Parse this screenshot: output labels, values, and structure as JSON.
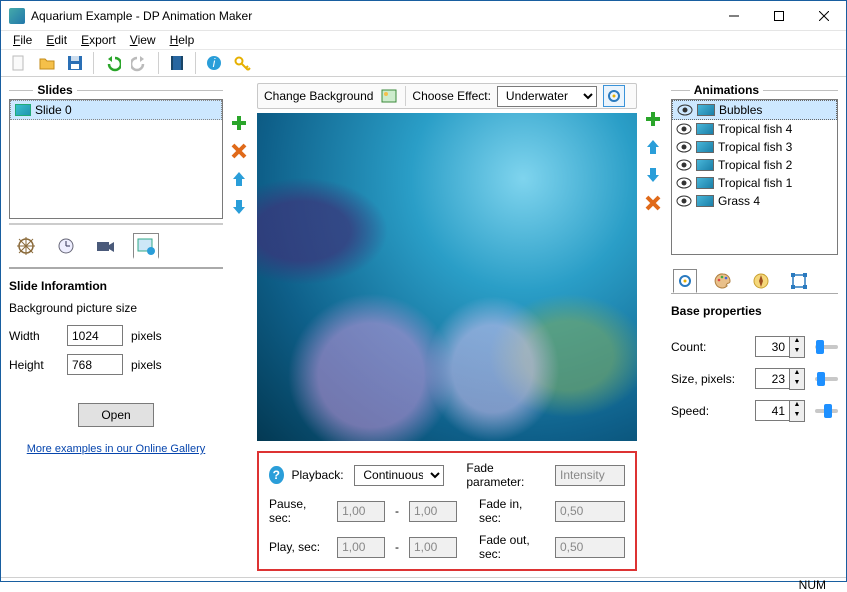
{
  "title": "Aquarium Example - DP Animation Maker",
  "menu": {
    "file": "File",
    "edit": "Edit",
    "export": "Export",
    "view": "View",
    "help": "Help"
  },
  "left": {
    "slides_title": "Slides",
    "slide0": "Slide 0",
    "info_title": "Slide Inforamtion",
    "bgsize_label": "Background picture size",
    "width_label": "Width",
    "width_value": "1024",
    "height_label": "Height",
    "height_value": "768",
    "pixels": "pixels",
    "open": "Open",
    "gallery_link": "More examples in our Online Gallery"
  },
  "center": {
    "change_bg": "Change Background",
    "choose_effect": "Choose Effect:",
    "effect_value": "Underwater",
    "playback_label": "Playback:",
    "playback_value": "Continuous",
    "fade_param_label": "Fade parameter:",
    "fade_param_value": "Intensity",
    "pause_label": "Pause, sec:",
    "play_label": "Play, sec:",
    "fadein_label": "Fade in, sec:",
    "fadeout_label": "Fade out, sec:",
    "v100": "1,00",
    "v050": "0,50"
  },
  "right": {
    "anim_title": "Animations",
    "items": [
      "Bubbles",
      "Tropical fish 4",
      "Tropical fish 3",
      "Tropical fish 2",
      "Tropical fish 1",
      "Grass 4"
    ],
    "base_title": "Base properties",
    "count_label": "Count:",
    "count_value": "30",
    "size_label": "Size, pixels:",
    "size_value": "23",
    "speed_label": "Speed:",
    "speed_value": "41"
  },
  "status": {
    "num": "NUM"
  }
}
